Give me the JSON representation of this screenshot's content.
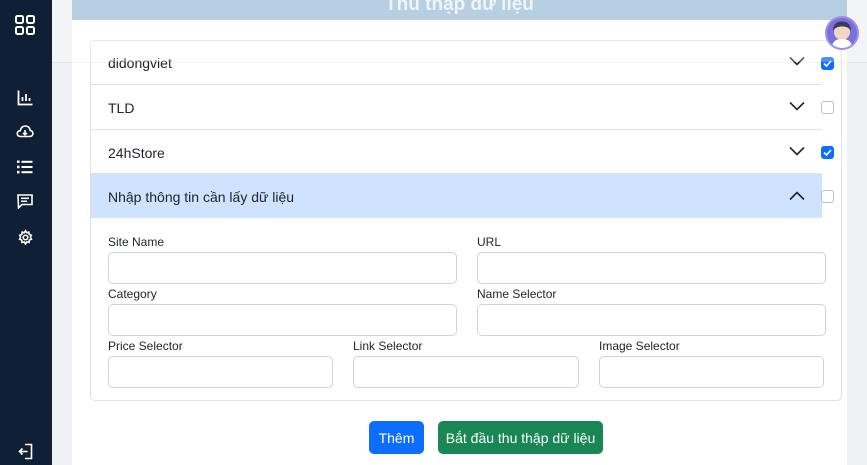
{
  "header": {
    "title": "Thu thập dữ liệu"
  },
  "sidebar": {
    "items": [
      {
        "name": "grid-icon"
      },
      {
        "name": "bar-chart-icon"
      },
      {
        "name": "cloud-download-icon"
      },
      {
        "name": "list-icon"
      },
      {
        "name": "message-icon"
      },
      {
        "name": "gear-icon"
      },
      {
        "name": "logout-icon"
      }
    ]
  },
  "sources": [
    {
      "label": "didongviet",
      "checked": true
    },
    {
      "label": "TLD",
      "checked": false
    },
    {
      "label": "24hStore",
      "checked": true
    }
  ],
  "form_panel": {
    "title": "Nhập thông tin cần lấy dữ liệu",
    "expanded": true,
    "checked": false,
    "fields": {
      "site_name": {
        "label": "Site Name",
        "value": ""
      },
      "url": {
        "label": "URL",
        "value": ""
      },
      "category": {
        "label": "Category",
        "value": ""
      },
      "name_selector": {
        "label": "Name Selector",
        "value": ""
      },
      "price_selector": {
        "label": "Price Selector",
        "value": ""
      },
      "link_selector": {
        "label": "Link Selector",
        "value": ""
      },
      "image_selector": {
        "label": "Image Selector",
        "value": ""
      }
    }
  },
  "actions": {
    "add_label": "Thêm",
    "start_label": "Bắt đầu thu thập dữ liệu"
  },
  "colors": {
    "sidebar_bg": "#0f1f35",
    "accent": "#0d6efd",
    "success": "#198754",
    "active_panel": "#cfe2ff"
  }
}
